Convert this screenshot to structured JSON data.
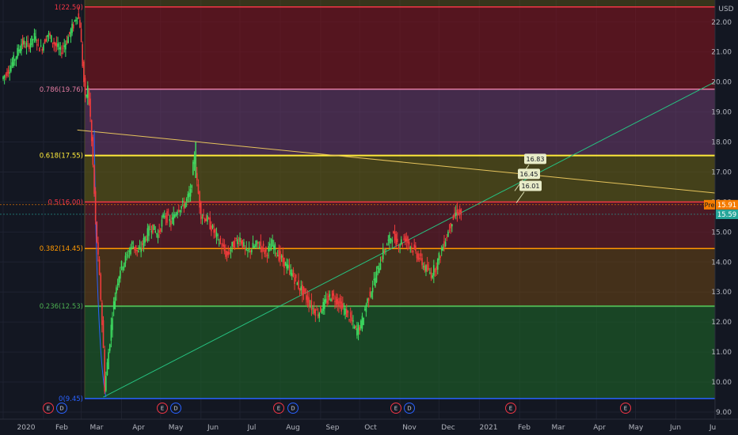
{
  "chart_data": {
    "type": "candlestick",
    "currency_label": "USD",
    "y_ticks": [
      "9.00",
      "10.00",
      "11.00",
      "12.00",
      "13.00",
      "14.00",
      "15.00",
      "16.00",
      "17.00",
      "18.00",
      "19.00",
      "20.00",
      "21.00",
      "22.00"
    ],
    "x_ticks": [
      "2020",
      "Feb",
      "Mar",
      "Apr",
      "May",
      "Jun",
      "Jul",
      "Aug",
      "Sep",
      "Oct",
      "Nov",
      "Dec",
      "2021",
      "Feb",
      "Mar",
      "Apr",
      "May",
      "Jun",
      "Ju"
    ],
    "ylim": [
      9.0,
      22.6
    ],
    "fib_levels": [
      {
        "ratio": 1.0,
        "label": "1(22.50)",
        "price": 22.5,
        "color": "#f23645"
      },
      {
        "ratio": 0.786,
        "label": "0.786(19.76)",
        "price": 19.76,
        "color": "#e07aa0"
      },
      {
        "ratio": 0.618,
        "label": "0.618(17.55)",
        "price": 17.55,
        "color": "#ffeb3b"
      },
      {
        "ratio": 0.5,
        "label": "0.5(16.00)",
        "price": 16.0,
        "color": "#f23645"
      },
      {
        "ratio": 0.382,
        "label": "0.382(14.45)",
        "price": 14.45,
        "color": "#ff9800"
      },
      {
        "ratio": 0.236,
        "label": "0.236(12.53)",
        "price": 12.53,
        "color": "#4caf50"
      },
      {
        "ratio": 0.0,
        "label": "0(9.45)",
        "price": 9.45,
        "color": "#2962ff"
      }
    ],
    "price_tags": [
      {
        "label": "Pre",
        "value": "15.91",
        "price": 15.91,
        "color": "#f57c00"
      },
      {
        "value": "15.59",
        "price": 15.59,
        "color": "#26a69a"
      }
    ],
    "annotations": [
      {
        "label": "16.83",
        "price": 17.45
      },
      {
        "label": "16.45",
        "price": 16.95
      },
      {
        "label": "16.01",
        "price": 16.55
      }
    ],
    "events": [
      {
        "label": "E",
        "type": "earnings"
      },
      {
        "label": "D",
        "type": "dividend"
      },
      {
        "label": "E",
        "type": "earnings"
      },
      {
        "label": "D",
        "type": "dividend"
      },
      {
        "label": "E",
        "type": "earnings"
      },
      {
        "label": "D",
        "type": "dividend"
      },
      {
        "label": "E",
        "type": "earnings"
      },
      {
        "label": "D",
        "type": "dividend"
      },
      {
        "label": "E",
        "type": "earnings"
      },
      {
        "label": "E",
        "type": "earnings"
      }
    ],
    "trendlines": [
      {
        "name": "down-trendline",
        "color": "#e6c35c",
        "from": [
          "2020-02-27",
          18.4
        ],
        "to": [
          "2021-07-01",
          16.3
        ]
      },
      {
        "name": "up-trendline",
        "color": "#26c281",
        "from": [
          "2020-03-18",
          9.5
        ],
        "to": [
          "2021-07-01",
          20.0
        ]
      }
    ],
    "candles": [
      {
        "d": 0,
        "c": 20.1
      },
      {
        "d": 5,
        "c": 20.4
      },
      {
        "d": 10,
        "c": 20.8
      },
      {
        "d": 15,
        "c": 21.3
      },
      {
        "d": 20,
        "c": 21.2
      },
      {
        "d": 25,
        "c": 21.5
      },
      {
        "d": 30,
        "c": 21.1
      },
      {
        "d": 35,
        "c": 21.6
      },
      {
        "d": 40,
        "c": 21.3
      },
      {
        "d": 45,
        "c": 21.0
      },
      {
        "d": 50,
        "c": 21.4
      },
      {
        "d": 55,
        "c": 21.9
      },
      {
        "d": 58,
        "c": 22.3
      },
      {
        "d": 60,
        "c": 21.9
      },
      {
        "d": 62,
        "c": 20.6
      },
      {
        "d": 64,
        "c": 19.4
      },
      {
        "d": 66,
        "c": 19.8
      },
      {
        "d": 68,
        "c": 18.8
      },
      {
        "d": 70,
        "c": 17.2
      },
      {
        "d": 72,
        "c": 15.3
      },
      {
        "d": 74,
        "c": 14.1
      },
      {
        "d": 76,
        "c": 12.8
      },
      {
        "d": 78,
        "c": 11.1
      },
      {
        "d": 79,
        "c": 9.8
      },
      {
        "d": 81,
        "c": 10.6
      },
      {
        "d": 83,
        "c": 11.4
      },
      {
        "d": 85,
        "c": 12.3
      },
      {
        "d": 88,
        "c": 13.2
      },
      {
        "d": 91,
        "c": 13.8
      },
      {
        "d": 95,
        "c": 14.1
      },
      {
        "d": 100,
        "c": 14.6
      },
      {
        "d": 105,
        "c": 14.3
      },
      {
        "d": 110,
        "c": 14.8
      },
      {
        "d": 115,
        "c": 15.2
      },
      {
        "d": 120,
        "c": 14.9
      },
      {
        "d": 125,
        "c": 15.6
      },
      {
        "d": 130,
        "c": 15.3
      },
      {
        "d": 135,
        "c": 15.8
      },
      {
        "d": 140,
        "c": 15.9
      },
      {
        "d": 145,
        "c": 16.3
      },
      {
        "d": 148,
        "c": 17.6
      },
      {
        "d": 150,
        "c": 16.6
      },
      {
        "d": 153,
        "c": 15.6
      },
      {
        "d": 158,
        "c": 15.4
      },
      {
        "d": 163,
        "c": 15.0
      },
      {
        "d": 168,
        "c": 14.6
      },
      {
        "d": 173,
        "c": 14.2
      },
      {
        "d": 178,
        "c": 14.6
      },
      {
        "d": 183,
        "c": 14.8
      },
      {
        "d": 188,
        "c": 14.3
      },
      {
        "d": 193,
        "c": 14.5
      },
      {
        "d": 198,
        "c": 14.6
      },
      {
        "d": 203,
        "c": 14.3
      },
      {
        "d": 208,
        "c": 14.6
      },
      {
        "d": 213,
        "c": 14.2
      },
      {
        "d": 218,
        "c": 13.9
      },
      {
        "d": 223,
        "c": 13.6
      },
      {
        "d": 228,
        "c": 13.2
      },
      {
        "d": 233,
        "c": 12.9
      },
      {
        "d": 238,
        "c": 12.5
      },
      {
        "d": 243,
        "c": 12.3
      },
      {
        "d": 248,
        "c": 12.6
      },
      {
        "d": 253,
        "c": 12.9
      },
      {
        "d": 258,
        "c": 12.7
      },
      {
        "d": 263,
        "c": 12.4
      },
      {
        "d": 268,
        "c": 12.1
      },
      {
        "d": 272,
        "c": 11.7
      },
      {
        "d": 276,
        "c": 11.9
      },
      {
        "d": 280,
        "c": 12.6
      },
      {
        "d": 284,
        "c": 13.1
      },
      {
        "d": 288,
        "c": 13.6
      },
      {
        "d": 292,
        "c": 14.2
      },
      {
        "d": 296,
        "c": 14.6
      },
      {
        "d": 300,
        "c": 14.9
      },
      {
        "d": 305,
        "c": 14.6
      },
      {
        "d": 310,
        "c": 14.8
      },
      {
        "d": 315,
        "c": 14.5
      },
      {
        "d": 320,
        "c": 14.2
      },
      {
        "d": 325,
        "c": 13.8
      },
      {
        "d": 330,
        "c": 13.6
      },
      {
        "d": 334,
        "c": 13.9
      },
      {
        "d": 338,
        "c": 14.4
      },
      {
        "d": 342,
        "c": 14.9
      },
      {
        "d": 346,
        "c": 15.4
      },
      {
        "d": 350,
        "c": 15.7
      },
      {
        "d": 353,
        "c": 15.6
      }
    ]
  }
}
